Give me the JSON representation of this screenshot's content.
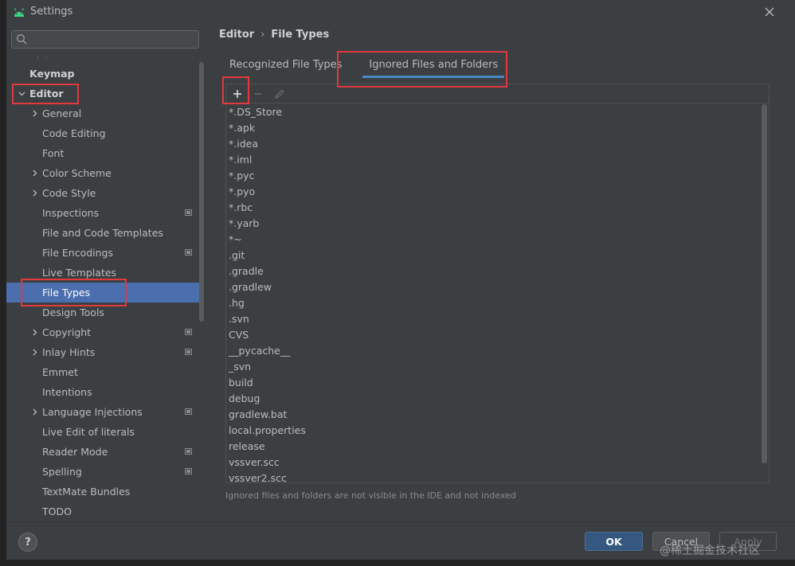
{
  "window": {
    "title": "Settings"
  },
  "search": {
    "value": "",
    "placeholder": ""
  },
  "sidebar": {
    "collapsed_indicator": "· ·",
    "items": [
      {
        "label": "Keymap",
        "level": 0,
        "bold": true
      },
      {
        "label": "Editor",
        "level": 0,
        "bold": true,
        "expanded": true
      },
      {
        "label": "General",
        "level": 1,
        "arrow": true
      },
      {
        "label": "Code Editing",
        "level": 1
      },
      {
        "label": "Font",
        "level": 1
      },
      {
        "label": "Color Scheme",
        "level": 1,
        "arrow": true
      },
      {
        "label": "Code Style",
        "level": 1,
        "arrow": true
      },
      {
        "label": "Inspections",
        "level": 1,
        "badge": true
      },
      {
        "label": "File and Code Templates",
        "level": 1
      },
      {
        "label": "File Encodings",
        "level": 1,
        "badge": true
      },
      {
        "label": "Live Templates",
        "level": 1
      },
      {
        "label": "File Types",
        "level": 1,
        "selected": true
      },
      {
        "label": "Design Tools",
        "level": 1
      },
      {
        "label": "Copyright",
        "level": 1,
        "arrow": true,
        "badge": true
      },
      {
        "label": "Inlay Hints",
        "level": 1,
        "arrow": true,
        "badge": true
      },
      {
        "label": "Emmet",
        "level": 1
      },
      {
        "label": "Intentions",
        "level": 1
      },
      {
        "label": "Language Injections",
        "level": 1,
        "arrow": true,
        "badge": true
      },
      {
        "label": "Live Edit of literals",
        "level": 1
      },
      {
        "label": "Reader Mode",
        "level": 1,
        "badge": true
      },
      {
        "label": "Spelling",
        "level": 1,
        "badge": true
      },
      {
        "label": "TextMate Bundles",
        "level": 1
      },
      {
        "label": "TODO",
        "level": 1
      }
    ]
  },
  "breadcrumb": {
    "parent": "Editor",
    "separator": "›",
    "current": "File Types"
  },
  "tabs": [
    {
      "label": "Recognized File Types",
      "active": false
    },
    {
      "label": "Ignored Files and Folders",
      "active": true
    }
  ],
  "toolbar": {
    "add": "+",
    "remove": "−"
  },
  "ignored_list": [
    "*.DS_Store",
    "*.apk",
    "*.idea",
    "*.iml",
    "*.pyc",
    "*.pyo",
    "*.rbc",
    "*.yarb",
    "*~",
    ".git",
    ".gradle",
    ".gradlew",
    ".hg",
    ".svn",
    "CVS",
    "__pycache__",
    "_svn",
    "build",
    "debug",
    "gradlew.bat",
    "local.properties",
    "release",
    "vssver.scc",
    "vssver2.scc"
  ],
  "hint": "Ignored files and folders are not visible in the IDE and not indexed",
  "footer": {
    "help": "?",
    "ok": "OK",
    "cancel": "Cancel",
    "apply": "Apply"
  },
  "watermark": "@稀土掘金技术社区",
  "colors": {
    "selection": "#4b6eaf",
    "highlight": "#e0393e",
    "accent": "#4a88c7",
    "ok_button": "#365880"
  }
}
